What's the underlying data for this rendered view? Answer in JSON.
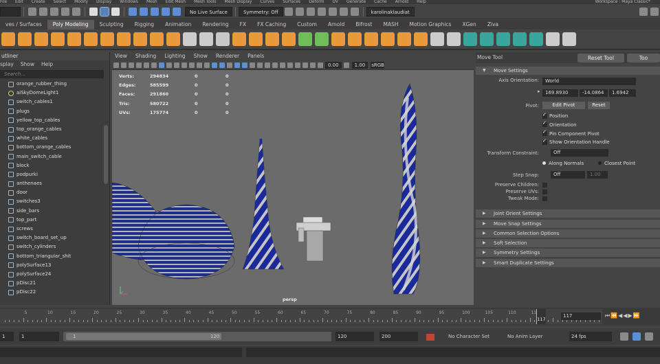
{
  "menubar": {
    "items": [
      "File",
      "Edit",
      "Create",
      "Select",
      "Modify",
      "Display",
      "Windows",
      "Mesh",
      "Edit Mesh",
      "Mesh Tools",
      "Mesh Display",
      "Curves",
      "Surfaces",
      "Deform",
      "UV",
      "Generate",
      "Cache",
      "Arnold",
      "Help"
    ],
    "workspace_label": "Workspace : Maya Classic*"
  },
  "statusline": {
    "mode_value": "",
    "live_surface": "No Live Surface",
    "symmetry": "Symmetry: Off",
    "user": "karolinaklaudiat"
  },
  "shelf": {
    "tabs": [
      "Curves / Surfaces",
      "Poly Modeling",
      "Sculpting",
      "Rigging",
      "Animation",
      "Rendering",
      "FX",
      "FX Caching",
      "Custom",
      "Arnold",
      "Bifrost",
      "MASH",
      "Motion Graphics",
      "XGen",
      "Ziva"
    ],
    "active_tab": "Poly Modeling",
    "partial_first_tab": "ves / Surfaces"
  },
  "outliner": {
    "title": "utliner",
    "menu": [
      "splay",
      "Show",
      "Help"
    ],
    "search_placeholder": "Search...",
    "items": [
      {
        "label": "orange_rubber_thing",
        "icon": "mesh-icon"
      },
      {
        "label": "aiSkyDomeLight1",
        "icon": "light-icon"
      },
      {
        "label": "switch_cables1",
        "icon": "mesh-icon"
      },
      {
        "label": "plugs",
        "icon": "mesh-icon"
      },
      {
        "label": "yellow_top_cables",
        "icon": "mesh-icon"
      },
      {
        "label": "top_orange_cables",
        "icon": "mesh-icon"
      },
      {
        "label": "white_cables",
        "icon": "mesh-icon"
      },
      {
        "label": "bottom_orange_cables",
        "icon": "mesh-icon"
      },
      {
        "label": "main_switch_cable",
        "icon": "mesh-icon"
      },
      {
        "label": "block",
        "icon": "mesh-icon"
      },
      {
        "label": "podpurki",
        "icon": "mesh-icon"
      },
      {
        "label": "anthenaes",
        "icon": "mesh-icon"
      },
      {
        "label": "door",
        "icon": "mesh-icon"
      },
      {
        "label": "switches3",
        "icon": "mesh-icon"
      },
      {
        "label": "side_bars",
        "icon": "mesh-icon"
      },
      {
        "label": "top_part",
        "icon": "mesh-icon"
      },
      {
        "label": "screws",
        "icon": "mesh-icon"
      },
      {
        "label": "switch_board_set_up",
        "icon": "mesh-icon"
      },
      {
        "label": "switch_cylinders",
        "icon": "mesh-icon"
      },
      {
        "label": "bottom_triangular_shit",
        "icon": "mesh-icon"
      },
      {
        "label": "polySurface13",
        "icon": "mesh-icon"
      },
      {
        "label": "polySurface24",
        "icon": "mesh-icon"
      },
      {
        "label": "pDisc21",
        "icon": "mesh-icon"
      },
      {
        "label": "pDisc22",
        "icon": "mesh-icon"
      }
    ]
  },
  "viewport": {
    "menu": [
      "View",
      "Shading",
      "Lighting",
      "Show",
      "Renderer",
      "Panels"
    ],
    "exposure": "0.00",
    "gamma": "1.00",
    "color_space": "sRGB",
    "hud": [
      {
        "label": "Verts:",
        "v1": "294834",
        "v2": "0",
        "v3": "0"
      },
      {
        "label": "Edges:",
        "v1": "585599",
        "v2": "0",
        "v3": "0"
      },
      {
        "label": "Faces:",
        "v1": "291860",
        "v2": "0",
        "v3": "0"
      },
      {
        "label": "Tris:",
        "v1": "580722",
        "v2": "0",
        "v3": "0"
      },
      {
        "label": "UVs:",
        "v1": "175774",
        "v2": "0",
        "v3": "0"
      }
    ],
    "camera": "persp"
  },
  "attr": {
    "title": "Move Tool",
    "reset_tool": "Reset Tool",
    "tool_help": "Too",
    "move_settings": "Move Settings",
    "axis_orientation_label": "Axis Orientation:",
    "axis_orientation_value": "World",
    "coords": [
      "169.8930",
      "-14.0864",
      "1.6942"
    ],
    "pivot_label": "Pivot:",
    "edit_pivot": "Edit Pivot",
    "reset": "Reset",
    "checkboxes": [
      {
        "label": "Position",
        "checked": true
      },
      {
        "label": "Orientation",
        "checked": true
      },
      {
        "label": "Pin Component Pivot",
        "checked": true
      },
      {
        "label": "Show Orientation Handle",
        "checked": true
      }
    ],
    "transform_constraint_label": "Transform Constraint:",
    "transform_constraint_value": "Off",
    "along_normals": "Along Normals",
    "closest_point": "Closest Point",
    "step_snap_label": "Step Snap:",
    "step_snap_value": "Off",
    "step_snap_num": "1.00",
    "preserve_children": "Preserve Children:",
    "preserve_uvs": "Preserve UVs:",
    "tweak_mode": "Tweak Mode:",
    "sections": [
      "Joint Orient Settings",
      "Move Snap Settings",
      "Common Selection Options",
      "Soft Selection",
      "Symmetry Settings",
      "Smart Duplicate Settings"
    ]
  },
  "timeslider": {
    "ticks": [
      "5",
      "10",
      "15",
      "20",
      "25",
      "30",
      "35",
      "40",
      "45",
      "50",
      "55",
      "60",
      "65",
      "70",
      "75",
      "80",
      "85",
      "90",
      "95",
      "100",
      "105",
      "110",
      "115"
    ],
    "current_frame": "117",
    "frame_field": "117"
  },
  "rangeslider": {
    "start": "1",
    "anim_start": "1",
    "range_left": "1",
    "range_right": "120",
    "end": "120",
    "anim_end": "200",
    "character_set": "No Character Set",
    "anim_layer": "No Anim Layer",
    "fps": "24 fps"
  }
}
